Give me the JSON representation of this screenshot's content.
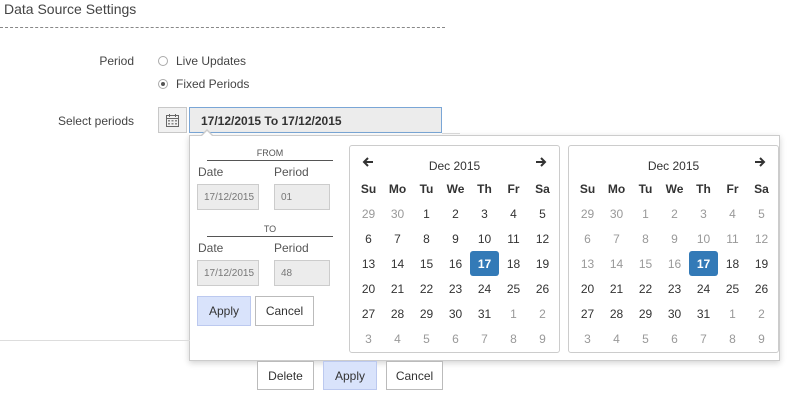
{
  "section": {
    "title": "Data Source Settings"
  },
  "period": {
    "label": "Period",
    "options": [
      {
        "label": "Live Updates",
        "selected": false
      },
      {
        "label": "Fixed Periods",
        "selected": true
      }
    ]
  },
  "select_periods": {
    "label": "Select periods",
    "value": "17/12/2015 To 17/12/2015",
    "icon": "calendar-icon"
  },
  "popup": {
    "from": {
      "header": "FROM",
      "date_label": "Date",
      "period_label": "Period",
      "date_value": "17/12/2015",
      "period_value": "01"
    },
    "to": {
      "header": "TO",
      "date_label": "Date",
      "period_label": "Period",
      "date_value": "17/12/2015",
      "period_value": "48"
    },
    "apply": "Apply",
    "cancel": "Cancel"
  },
  "calendars": [
    {
      "month": "Dec 2015",
      "prev": "🡐",
      "next": "🡒",
      "selected": 17
    },
    {
      "month": "Dec 2015",
      "next": "🡒",
      "selected": 17
    }
  ],
  "weekdays": [
    "Su",
    "Mo",
    "Tu",
    "We",
    "Th",
    "Fr",
    "Sa"
  ],
  "weeks": [
    [
      "29",
      "30",
      "1",
      "2",
      "3",
      "4",
      "5"
    ],
    [
      "6",
      "7",
      "8",
      "9",
      "10",
      "11",
      "12"
    ],
    [
      "13",
      "14",
      "15",
      "16",
      "17",
      "18",
      "19"
    ],
    [
      "20",
      "21",
      "22",
      "23",
      "24",
      "25",
      "26"
    ],
    [
      "27",
      "28",
      "29",
      "30",
      "31",
      "1",
      "2"
    ],
    [
      "3",
      "4",
      "5",
      "6",
      "7",
      "8",
      "9"
    ]
  ],
  "footer": {
    "delete": "Delete",
    "apply": "Apply",
    "cancel": "Cancel"
  },
  "colors": {
    "selected": "#337ab7",
    "primary_button": "#d9e3fb"
  }
}
